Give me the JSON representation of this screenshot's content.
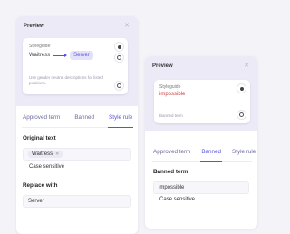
{
  "left_panel": {
    "preview_title": "Preview",
    "card": {
      "label": "Styleguide",
      "original_word": "Waitress",
      "replacement_word": "Server",
      "help_text": "Use gender neutral descriptions for listed positions."
    },
    "tabs": [
      {
        "label": "Approved term",
        "active": false
      },
      {
        "label": "Banned",
        "active": false
      },
      {
        "label": "Style rule",
        "active": true
      }
    ],
    "original_text_title": "Original text",
    "original_chip": "Waitress",
    "case_sensitive": "Case sensitive",
    "replace_with_title": "Replace with",
    "replace_value": "Server"
  },
  "right_panel": {
    "preview_title": "Preview",
    "card": {
      "label": "Styleguide",
      "flagged_word": "impossible",
      "note": "Banned term"
    },
    "tabs": [
      {
        "label": "Approved term",
        "active": false
      },
      {
        "label": "Banned",
        "active": true
      },
      {
        "label": "Style rule",
        "active": false
      }
    ],
    "banned_term_title": "Banned term",
    "banned_value": "impossible",
    "case_sensitive": "Case sensitive"
  },
  "colors": {
    "accent": "#5a53d6",
    "banned_red": "#d33a3a",
    "preview_bg": "#eceaf6"
  }
}
